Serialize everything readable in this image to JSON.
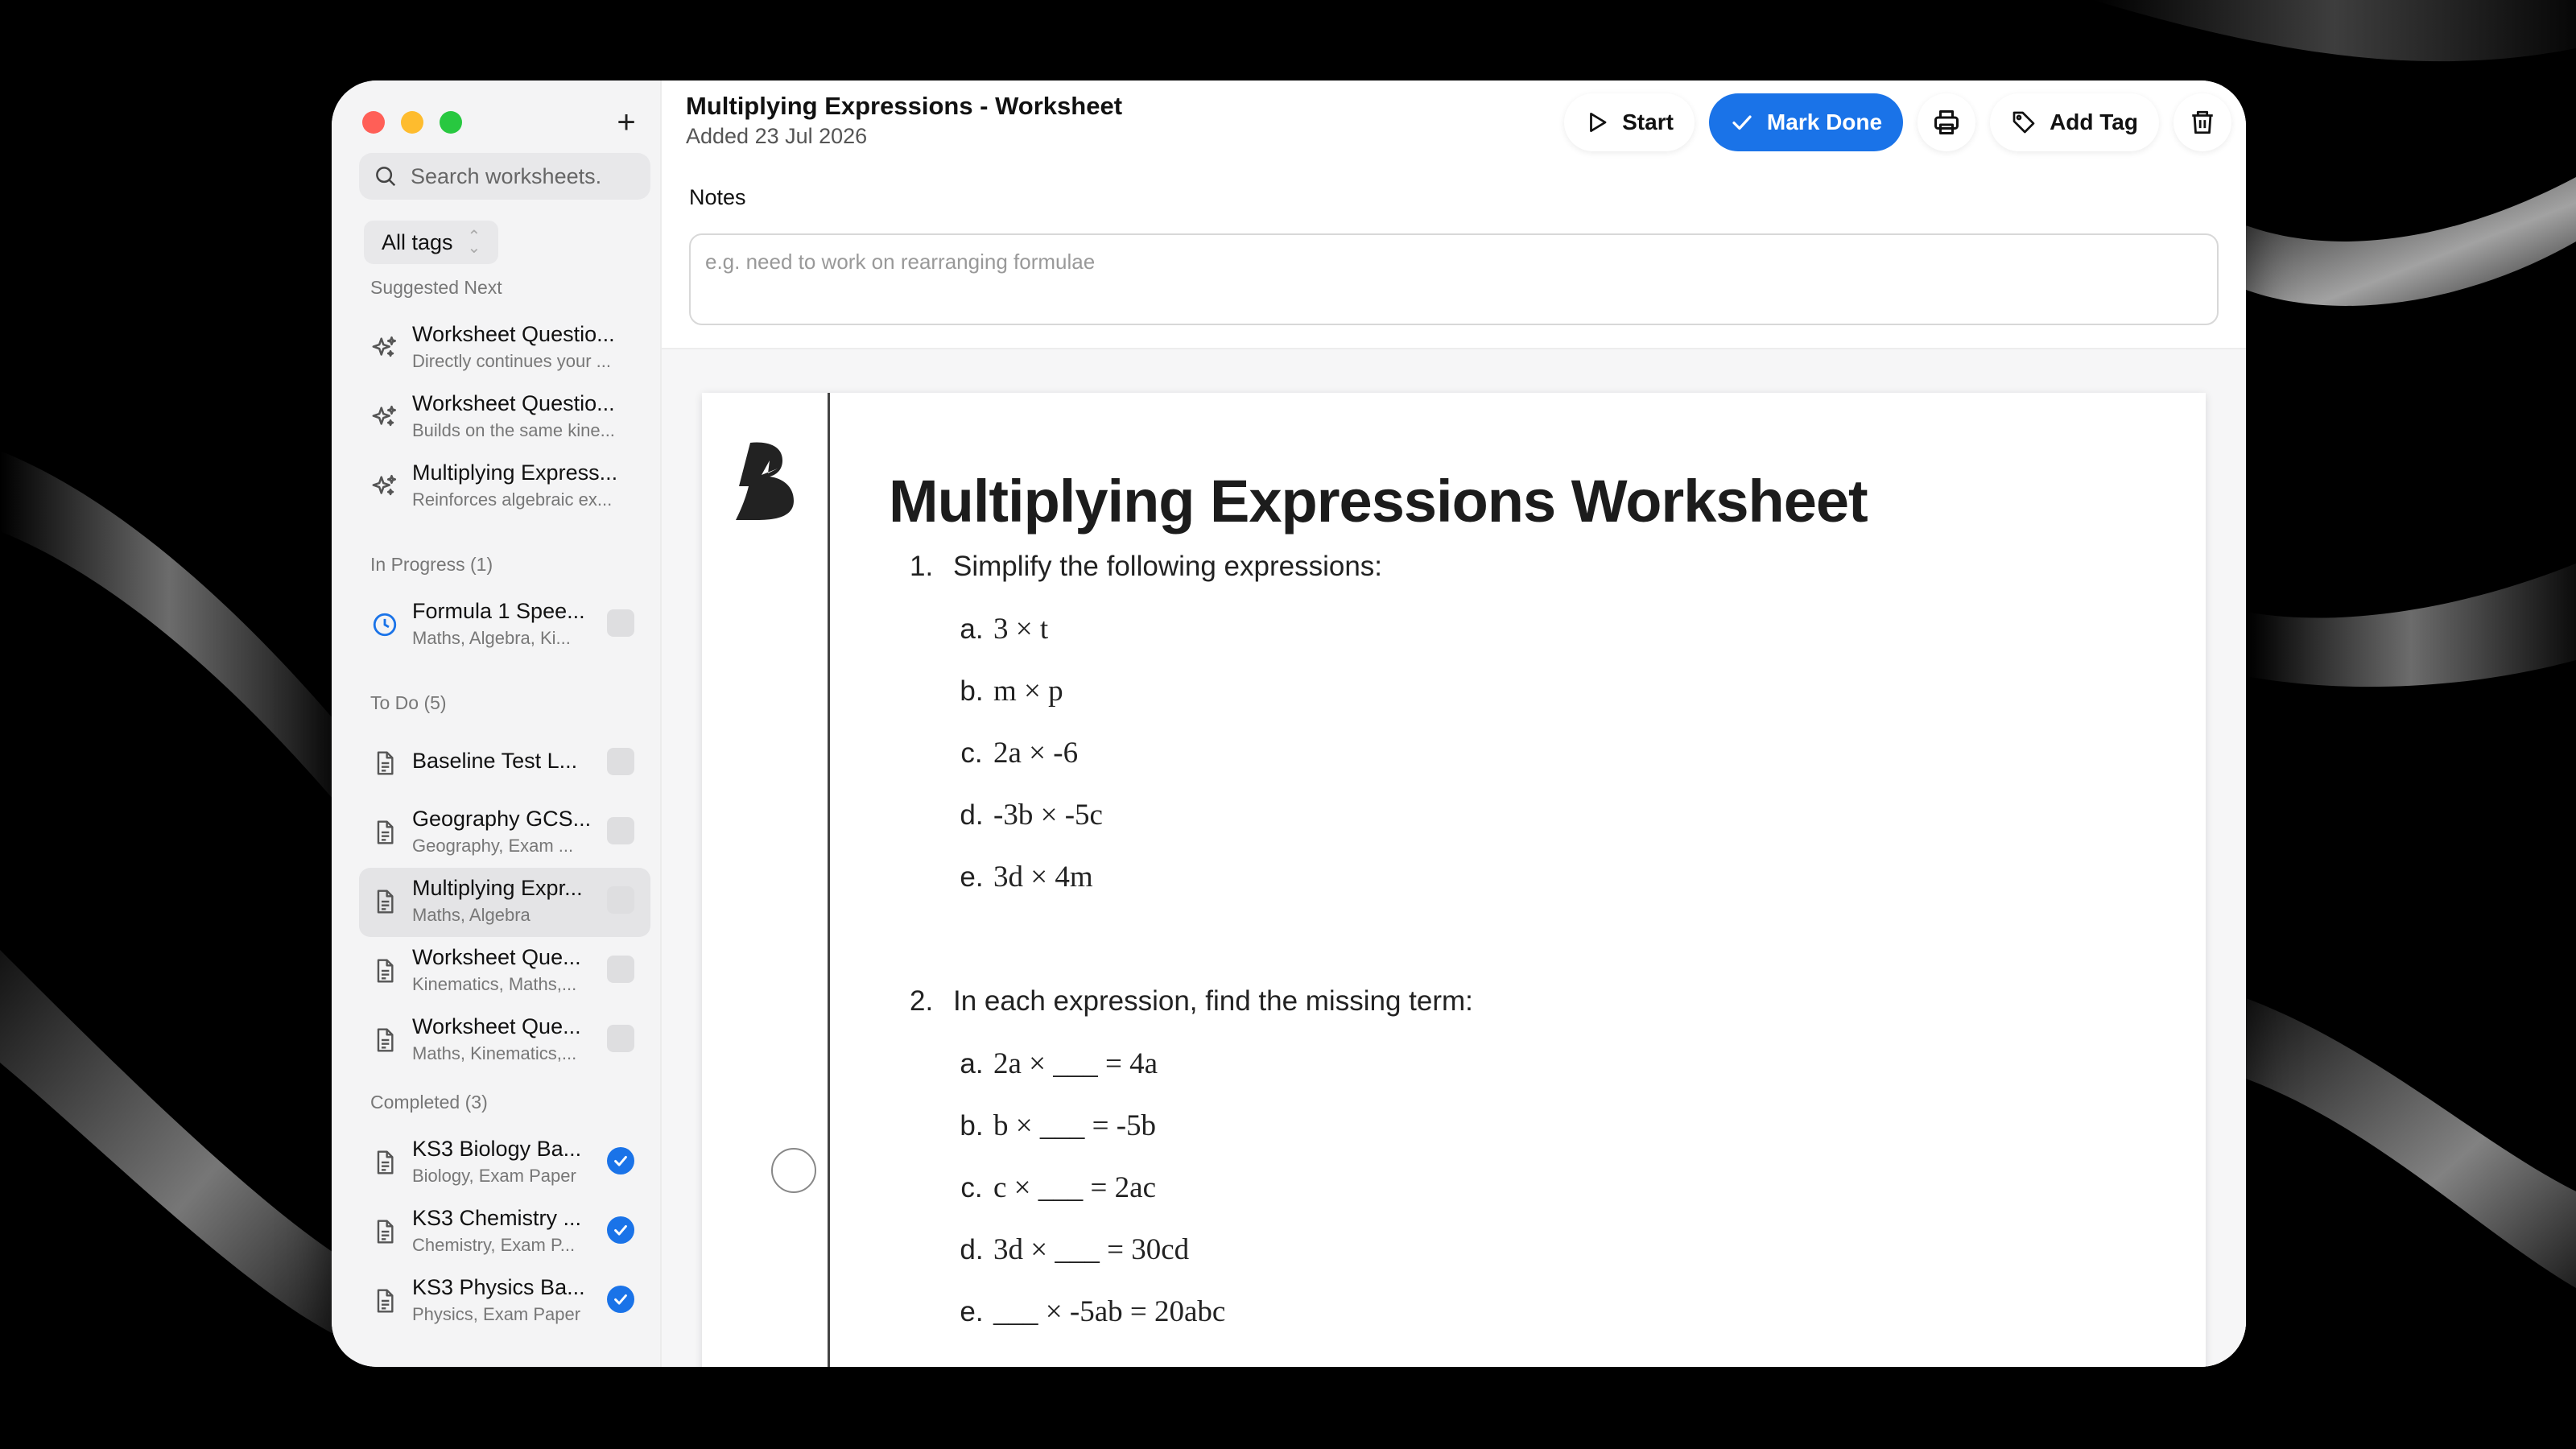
{
  "sidebar": {
    "search_placeholder": "Search worksheets.",
    "tag_filter": "All tags",
    "sections": {
      "suggested": "Suggested Next",
      "in_progress": "In Progress (1)",
      "todo": "To Do (5)",
      "completed": "Completed (3)"
    },
    "suggested": [
      {
        "title": "Worksheet Questio...",
        "sub": "Directly continues your ..."
      },
      {
        "title": "Worksheet Questio...",
        "sub": "Builds on the same kine..."
      },
      {
        "title": "Multiplying Express...",
        "sub": "Reinforces algebraic ex..."
      }
    ],
    "in_progress": [
      {
        "title": "Formula 1 Spee...",
        "sub": "Maths, Algebra, Ki..."
      }
    ],
    "todo": [
      {
        "title": "Baseline Test L...",
        "sub": ""
      },
      {
        "title": "Geography GCS...",
        "sub": "Geography, Exam ..."
      },
      {
        "title": "Multiplying Expr...",
        "sub": "Maths, Algebra"
      },
      {
        "title": "Worksheet Que...",
        "sub": "Kinematics, Maths,..."
      },
      {
        "title": "Worksheet Que...",
        "sub": "Maths, Kinematics,..."
      }
    ],
    "completed": [
      {
        "title": "KS3 Biology Ba...",
        "sub": "Biology, Exam Paper"
      },
      {
        "title": "KS3 Chemistry ...",
        "sub": "Chemistry, Exam P..."
      },
      {
        "title": "KS3 Physics Ba...",
        "sub": "Physics, Exam Paper"
      }
    ]
  },
  "header": {
    "title": "Multiplying Expressions - Worksheet",
    "added": "Added 23 Jul 2026"
  },
  "toolbar": {
    "start": "Start",
    "mark_done": "Mark Done",
    "add_tag": "Add Tag"
  },
  "notes": {
    "label": "Notes",
    "placeholder": "e.g. need to work on rearranging formulae"
  },
  "worksheet": {
    "heading": "Multiplying Expressions Worksheet",
    "q1": {
      "num": "1.",
      "text": "Simplify the following expressions:",
      "parts": [
        {
          "l": "a.",
          "e": "3 × t"
        },
        {
          "l": "b.",
          "e": "m × p"
        },
        {
          "l": "c.",
          "e": "2a × -6"
        },
        {
          "l": "d.",
          "e": "-3b × -5c"
        },
        {
          "l": "e.",
          "e": "3d × 4m"
        }
      ]
    },
    "q2": {
      "num": "2.",
      "text": "In each expression, find the missing term:",
      "parts": [
        {
          "l": "a.",
          "e": "2a × ___ = 4a"
        },
        {
          "l": "b.",
          "e": "b × ___ = -5b"
        },
        {
          "l": "c.",
          "e": "c × ___ = 2ac"
        },
        {
          "l": "d.",
          "e": "3d × ___ = 30cd"
        },
        {
          "l": "e.",
          "e": "___ × -5ab = 20abc"
        }
      ]
    }
  },
  "colors": {
    "accent": "#1a73e8",
    "sidebar_bg": "#f4f4f5",
    "traffic_red": "#ff5f57",
    "traffic_yellow": "#febc2e",
    "traffic_green": "#28c840"
  }
}
